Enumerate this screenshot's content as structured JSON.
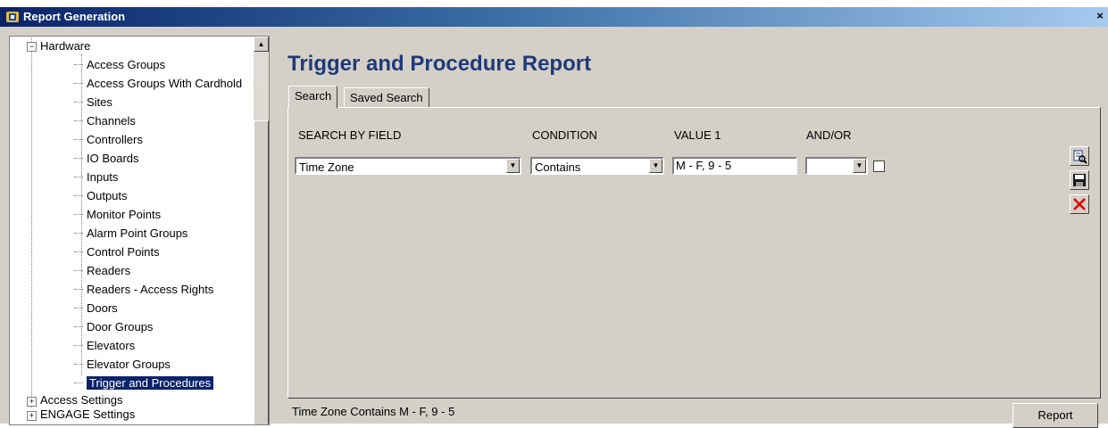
{
  "window": {
    "title": "Report Generation",
    "close_glyph": "×"
  },
  "tree": {
    "root": {
      "label": "Hardware",
      "expander": "−"
    },
    "children": [
      "Access Groups",
      "Access Groups With Cardhold",
      "Sites",
      "Channels",
      "Controllers",
      "IO Boards",
      "Inputs",
      "Outputs",
      "Monitor Points",
      "Alarm Point Groups",
      "Control Points",
      "Readers",
      "Readers - Access Rights",
      "Doors",
      "Door Groups",
      "Elevators",
      "Elevator Groups",
      "Trigger and Procedures"
    ],
    "selected": "Trigger and Procedures",
    "siblings": [
      {
        "label": "Access Settings",
        "expander": "+"
      },
      {
        "label": "ENGAGE Settings",
        "expander": "+"
      }
    ]
  },
  "main": {
    "title": "Trigger and Procedure Report",
    "tabs": [
      {
        "label": "Search",
        "active": true
      },
      {
        "label": "Saved Search",
        "active": false
      }
    ],
    "columns": {
      "field": "SEARCH BY FIELD",
      "condition": "CONDITION",
      "value1": "VALUE 1",
      "andor": "AND/OR"
    },
    "row": {
      "field_value": "Time Zone",
      "condition_value": "Contains",
      "value1": "M - F, 9 - 5",
      "andor_value": "",
      "checked": false
    },
    "tools": [
      "run-search-icon",
      "save-icon",
      "delete-icon"
    ],
    "status": "Time Zone Contains M - F, 9 - 5",
    "report_button": "Report"
  },
  "colors": {
    "accent": "#1f3a7a",
    "selection": "#0a246a",
    "face": "#d4d0c8",
    "delete": "#e00000"
  }
}
